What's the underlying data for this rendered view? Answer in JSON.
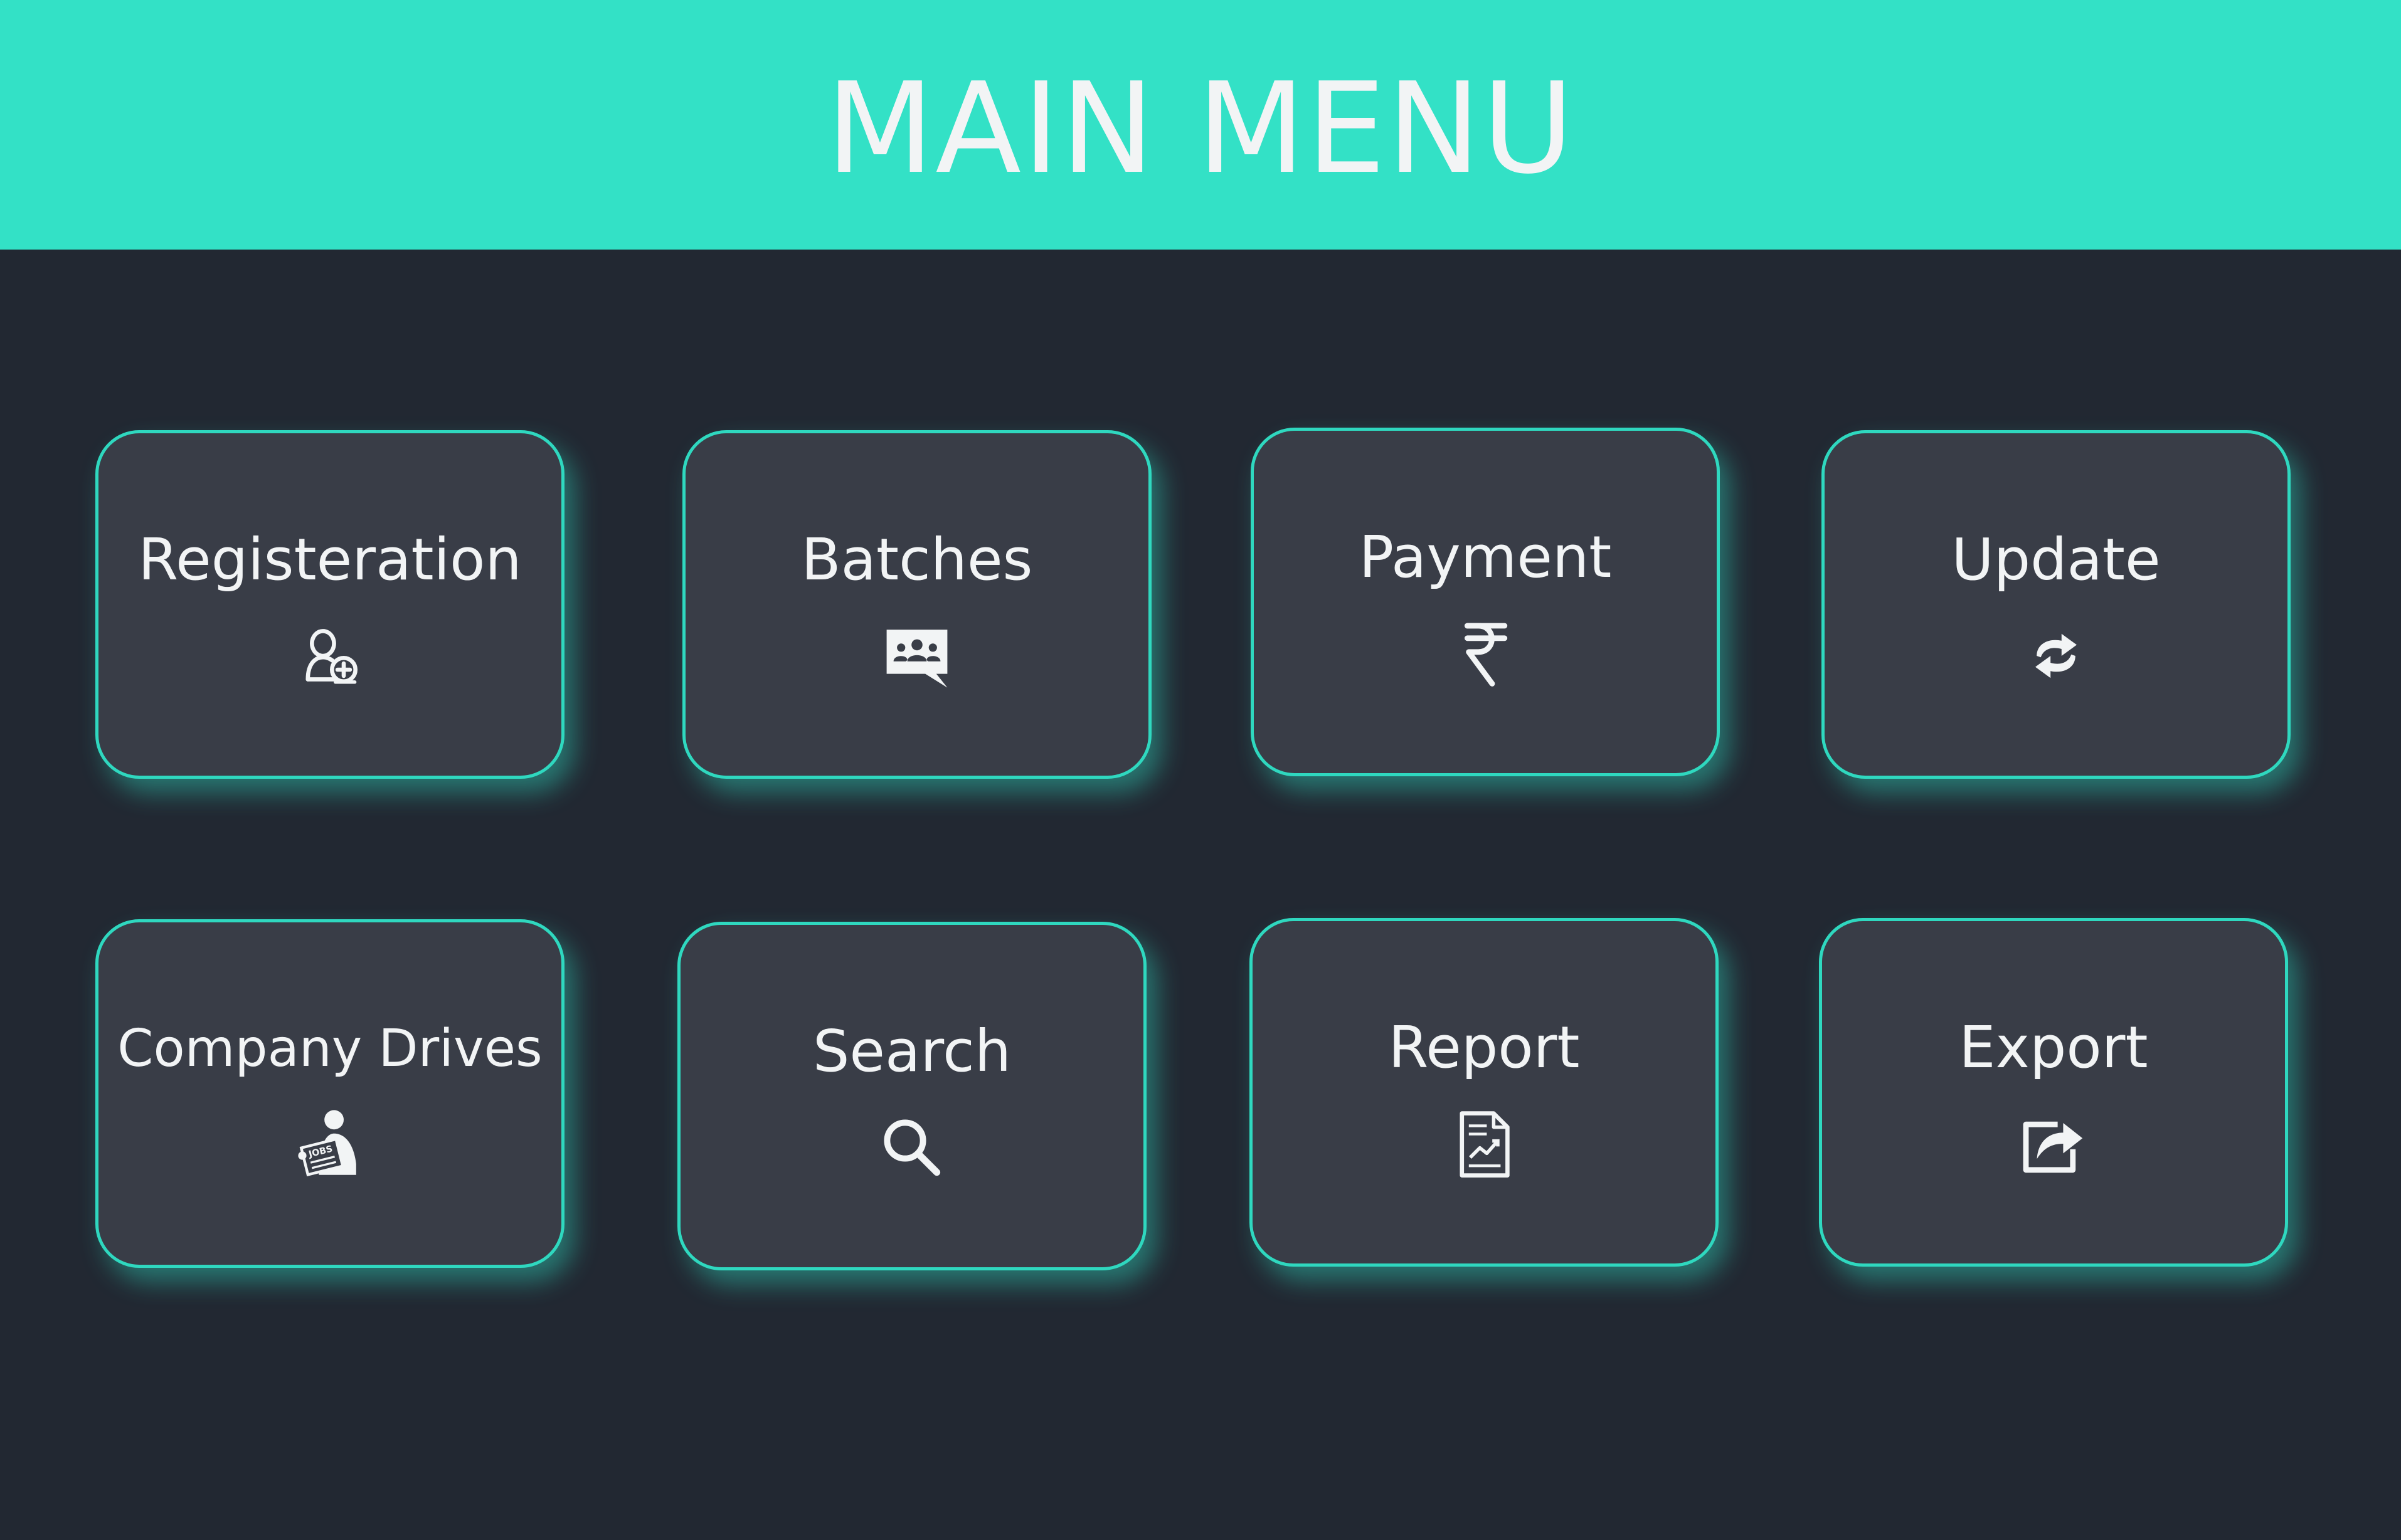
{
  "header": {
    "title": "MAIN MENU"
  },
  "colors": {
    "header_bg": "#33e1c6",
    "page_bg": "#222832",
    "tile_bg": "#393d47",
    "tile_border": "#2fd8bf",
    "text": "#f2f4f5"
  },
  "menu": {
    "items": [
      {
        "label": "Registeration",
        "icon": "add-user-icon"
      },
      {
        "label": "Batches",
        "icon": "group-chat-icon"
      },
      {
        "label": "Payment",
        "icon": "rupee-icon"
      },
      {
        "label": "Update",
        "icon": "refresh-icon"
      },
      {
        "label": "Company Drives",
        "icon": "job-seeker-icon"
      },
      {
        "label": "Search",
        "icon": "search-icon"
      },
      {
        "label": "Report",
        "icon": "report-document-icon"
      },
      {
        "label": "Export",
        "icon": "export-icon"
      }
    ]
  }
}
